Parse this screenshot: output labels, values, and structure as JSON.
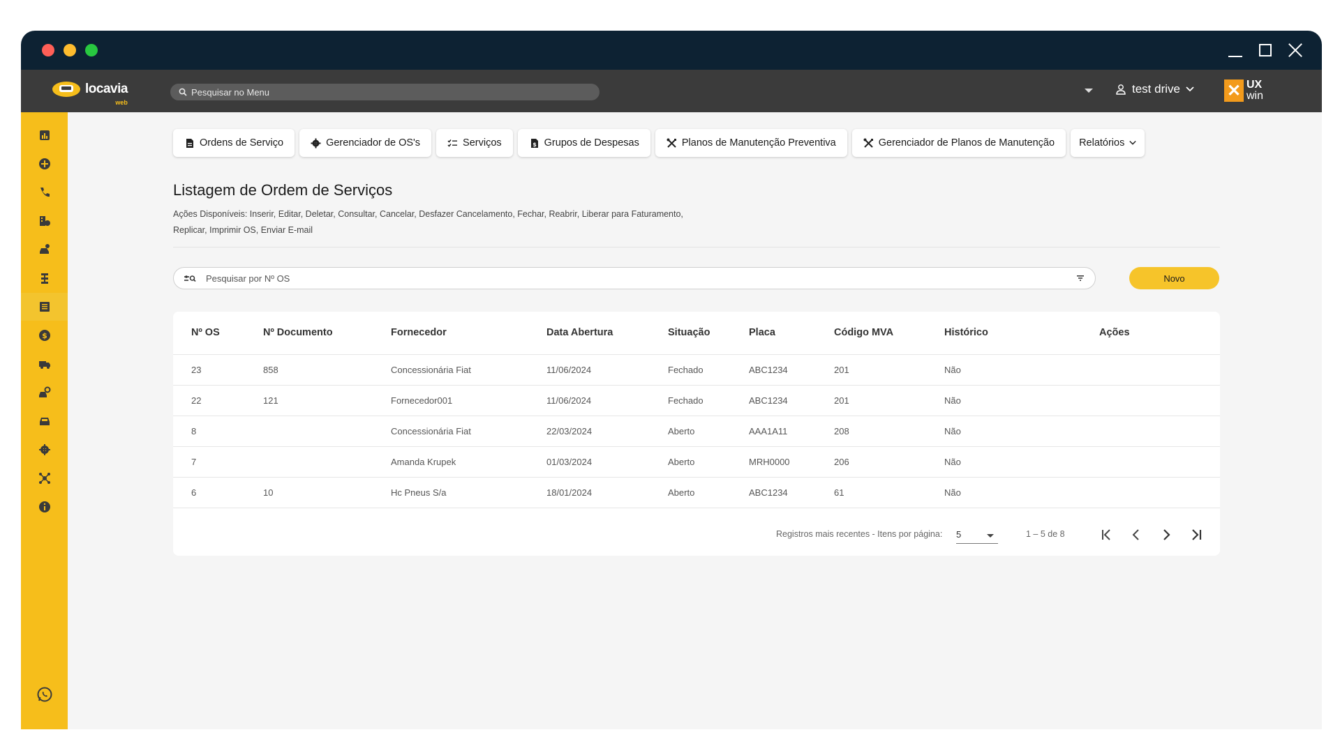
{
  "topbar": {
    "logo_text": "locavia",
    "logo_sub": "web",
    "search_placeholder": "Pesquisar no Menu",
    "user_name": "test drive",
    "brand_ux": "UX",
    "brand_win": "win"
  },
  "tabs": [
    {
      "label": "Ordens de Serviço",
      "icon": "document-icon"
    },
    {
      "label": "Gerenciador de OS's",
      "icon": "gear-icon"
    },
    {
      "label": "Serviços",
      "icon": "checklist-icon"
    },
    {
      "label": "Grupos de Despesas",
      "icon": "document-icon"
    },
    {
      "label": "Planos de Manutenção Preventiva",
      "icon": "tools-icon"
    },
    {
      "label": "Gerenciador de Planos de Manutenção",
      "icon": "tools-icon"
    },
    {
      "label": "Relatórios",
      "icon": "chevron-down-icon"
    }
  ],
  "page": {
    "title": "Listagem de Ordem de Serviços",
    "description": "Ações Disponíveis: Inserir, Editar, Deletar, Consultar, Cancelar, Desfazer Cancelamento, Fechar, Reabrir, Liberar para Faturamento, Replicar, Imprimir OS, Enviar E-mail"
  },
  "search": {
    "placeholder": "Pesquisar por Nº OS"
  },
  "buttons": {
    "new_label": "Novo"
  },
  "table": {
    "headers": [
      "Nº OS",
      "Nº Documento",
      "Fornecedor",
      "Data Abertura",
      "Situação",
      "Placa",
      "Código MVA",
      "Histórico",
      "Ações"
    ],
    "rows": [
      [
        "23",
        "858",
        "Concessionária Fiat",
        "11/06/2024",
        "Fechado",
        "ABC1234",
        "201",
        "Não"
      ],
      [
        "22",
        "121",
        "Fornecedor001",
        "11/06/2024",
        "Fechado",
        "ABC1234",
        "201",
        "Não"
      ],
      [
        "8",
        "",
        "Concessionária Fiat",
        "22/03/2024",
        "Aberto",
        "AAA1A11",
        "208",
        "Não"
      ],
      [
        "7",
        "",
        "Amanda Krupek",
        "01/03/2024",
        "Aberto",
        "MRH0000",
        "206",
        "Não"
      ],
      [
        "6",
        "10",
        "Hc Pneus S/a",
        "18/01/2024",
        "Aberto",
        "ABC1234",
        "61",
        "Não"
      ]
    ]
  },
  "pagination": {
    "label": "Registros mais recentes - Itens por página:",
    "page_size": "5",
    "range": "1 – 5 de 8"
  },
  "sidebar": {
    "items": [
      "chart-icon",
      "plus-circle-icon",
      "phone-icon",
      "building-dollar-icon",
      "car-key-icon",
      "road-icon",
      "list-document-icon",
      "dollar-circle-icon",
      "truck-icon",
      "car-search-icon",
      "car-icon",
      "gear-icon",
      "network-icon",
      "info-icon"
    ],
    "active_index": 6
  },
  "colors": {
    "accent": "#f6be1b",
    "titlebar": "#0d2233",
    "topbar": "#3b3b3b",
    "button": "#f6c42a"
  }
}
